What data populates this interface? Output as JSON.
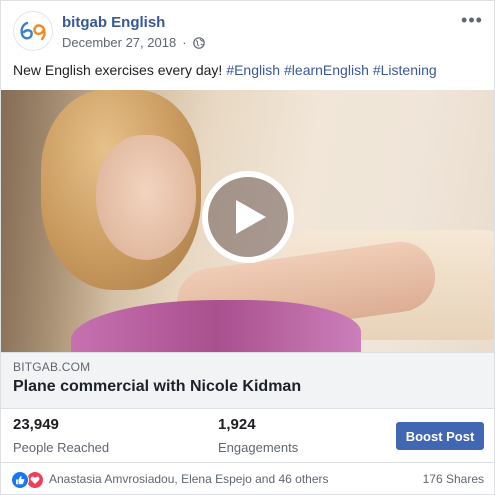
{
  "post": {
    "page_name": "bitgab English",
    "date": "December 27, 2018",
    "separator": "·",
    "more_label": "•••",
    "text": "New English exercises every day!",
    "hashtags": [
      "#English",
      "#learnEnglish",
      "#Listening"
    ],
    "privacy_icon": "globe-icon",
    "avatar_icon": "bitgab-logo"
  },
  "media": {
    "type": "video",
    "play_icon": "play-icon"
  },
  "link": {
    "domain": "BITGAB.COM",
    "title": "Plane commercial with Nicole Kidman"
  },
  "insights": {
    "people_reached_value": "23,949",
    "people_reached_label": "People Reached",
    "engagements_value": "1,924",
    "engagements_label": "Engagements",
    "boost_label": "Boost Post"
  },
  "footer": {
    "reactions": [
      "like-icon",
      "love-icon"
    ],
    "reactors_text": "Anastasia Amvrosiadou, Elena Espejo and 46 others",
    "shares_text": "176 Shares"
  },
  "colors": {
    "link_blue": "#385898",
    "boost_blue": "#4267b2",
    "like_blue": "#1877f2",
    "love_red": "#f33e58",
    "logo_blue": "#3b7ec9",
    "logo_orange": "#f08a24"
  }
}
